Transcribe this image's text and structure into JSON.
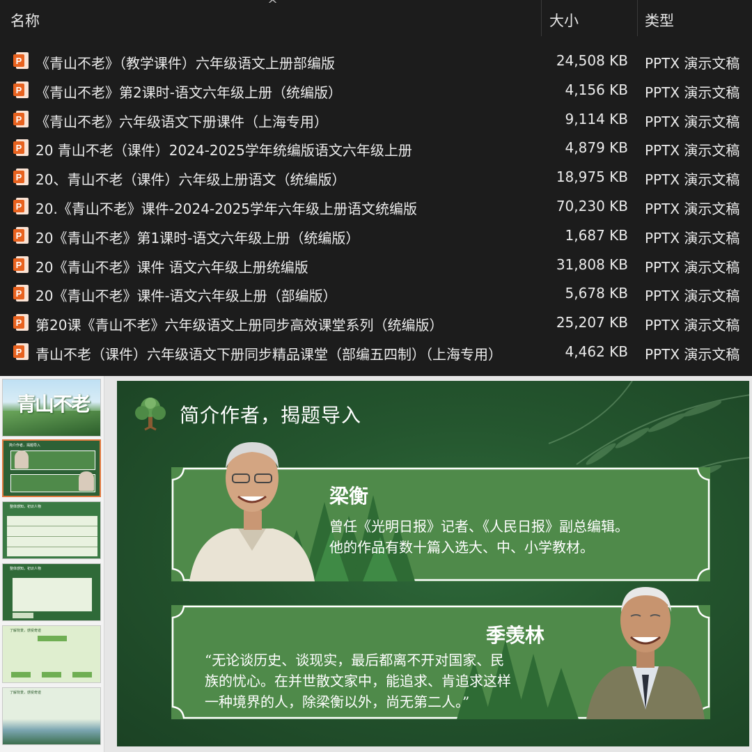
{
  "explorer": {
    "columns": {
      "name": "名称",
      "size": "大小",
      "type": "类型"
    },
    "sort_indicator": "^",
    "files": [
      {
        "name": "《青山不老》（教学课件）六年级语文上册部编版",
        "size": "24,508 KB",
        "type": "PPTX 演示文稿"
      },
      {
        "name": "《青山不老》第2课时-语文六年级上册（统编版）",
        "size": "4,156 KB",
        "type": "PPTX 演示文稿"
      },
      {
        "name": "《青山不老》六年级语文下册课件（上海专用）",
        "size": "9,114 KB",
        "type": "PPTX 演示文稿"
      },
      {
        "name": "20 青山不老（课件）2024-2025学年统编版语文六年级上册",
        "size": "4,879 KB",
        "type": "PPTX 演示文稿"
      },
      {
        "name": "20、青山不老（课件）六年级上册语文（统编版）",
        "size": "18,975 KB",
        "type": "PPTX 演示文稿"
      },
      {
        "name": "20.《青山不老》课件-2024-2025学年六年级上册语文统编版",
        "size": "70,230 KB",
        "type": "PPTX 演示文稿"
      },
      {
        "name": "20《青山不老》第1课时-语文六年级上册（统编版）",
        "size": "1,687 KB",
        "type": "PPTX 演示文稿"
      },
      {
        "name": "20《青山不老》课件 语文六年级上册统编版",
        "size": "31,808 KB",
        "type": "PPTX 演示文稿"
      },
      {
        "name": "20《青山不老》课件-语文六年级上册（部编版）",
        "size": "5,678 KB",
        "type": "PPTX 演示文稿"
      },
      {
        "name": "第20课《青山不老》六年级语文上册同步高效课堂系列（统编版）",
        "size": "25,207 KB",
        "type": "PPTX 演示文稿"
      },
      {
        "name": "青山不老（课件）六年级语文下册同步精品课堂（部编五四制）（上海专用）",
        "size": "4,462 KB",
        "type": "PPTX 演示文稿"
      }
    ],
    "file_icon": "pptx-file-icon",
    "icon_color": "#e8621f"
  },
  "thumbnails": [
    {
      "title": "青山不老"
    },
    {
      "title": "简介作者，揭题导入"
    },
    {
      "title": "整体感知，初识人物"
    },
    {
      "title": "整体感知，初识人物"
    },
    {
      "title": "了解背景，感受奇迹"
    },
    {
      "title": "了解背景，感受奇迹"
    }
  ],
  "slide": {
    "title": "简介作者，揭题导入",
    "person1": {
      "name": "梁衡",
      "line1": "曾任《光明日报》记者、《人民日报》副总编辑。",
      "line2": "他的作品有数十篇入选大、中、小学教材。"
    },
    "person2": {
      "name": "季羡林",
      "line1": "“无论谈历史、谈现实，最后都离不开对国家、民",
      "line2": "族的忧心。在并世散文家中，能追求、肯追求这样",
      "line3": "一种境界的人，除梁衡以外，尚无第二人。”"
    },
    "colors": {
      "bg": "#24552e",
      "card": "#4f8a4a",
      "border": "#ffffff"
    }
  }
}
